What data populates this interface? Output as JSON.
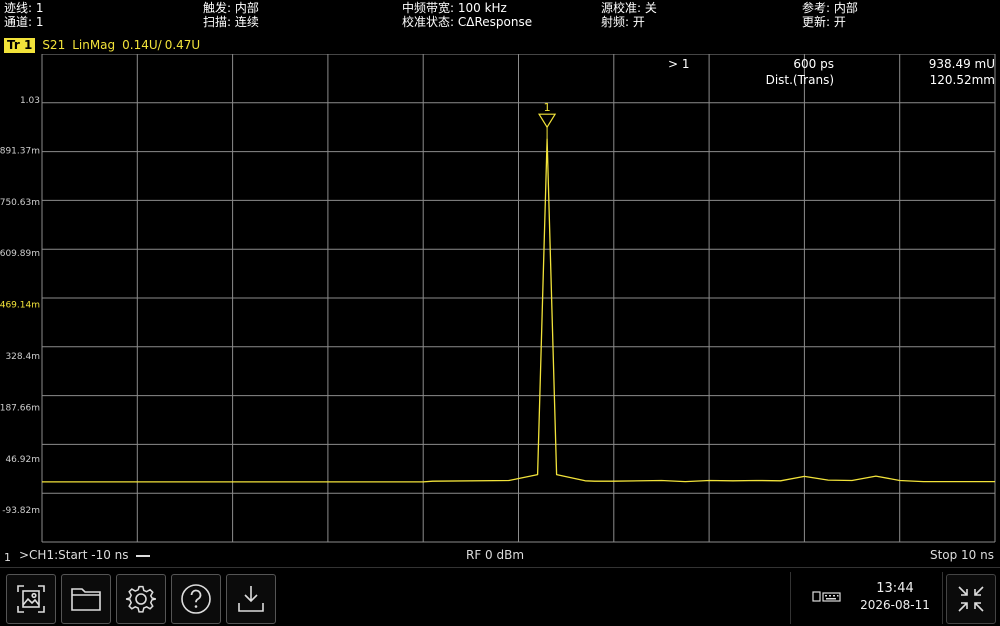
{
  "status": {
    "trace_count": "迹线: 1",
    "channel": "通道: 1",
    "trigger": "触发: 内部",
    "sweep": "扫描: 连续",
    "if_bw": "中频带宽: 100 kHz",
    "cal_state": "校准状态: CΔResponse",
    "source_cal": "源校准: 关",
    "rf": "射频: 开",
    "reference": "参考: 内部",
    "update": "更新: 开"
  },
  "trace": {
    "badge": "Tr 1",
    "param": "S21",
    "format": "LinMag",
    "scale": "0.14U/",
    "ref": "0.47U"
  },
  "marker_table": {
    "marker": "> 1",
    "x_value": "600 ps",
    "y_value": "938.49 mU",
    "x_label": "Dist.(Trans)",
    "distance": "120.52mm",
    "marker_label": "1"
  },
  "bottom": {
    "channel_marker": "1",
    "start": ">CH1:Start -10 ns",
    "power": "RF 0 dBm",
    "stop": "Stop 10 ns"
  },
  "clock": {
    "time": "13:44",
    "date": "2026-08-11"
  },
  "colors": {
    "trace": "#f2e33a",
    "grid": "#8c8c8c",
    "ref_label": "#f2e33a",
    "tick_label": "#cfcfcf"
  },
  "toolbar": {
    "buttons": [
      "screenshot-icon",
      "folder-icon",
      "gear-icon",
      "help-icon",
      "download-icon"
    ]
  },
  "chart_data": {
    "type": "line",
    "x": [
      -10,
      -3.0,
      -2.0,
      -1.8,
      -0.2,
      0.4,
      0.6,
      0.8,
      1.4,
      1.6,
      2.0,
      3.0,
      3.5,
      4.0,
      4.5,
      5.0,
      5.5,
      6.0,
      6.5,
      7.0,
      7.5,
      8.0,
      8.5,
      10
    ],
    "y": [
      0.0,
      0.0,
      0.0,
      0.002,
      0.004,
      0.02,
      0.9385,
      0.02,
      0.003,
      0.002,
      0.002,
      0.004,
      0.001,
      0.004,
      0.003,
      0.004,
      0.003,
      0.015,
      0.005,
      0.004,
      0.016,
      0.004,
      0.001,
      0.001
    ],
    "xlim": [
      -10,
      10
    ],
    "ylim": [
      -0.1645,
      1.1718
    ],
    "ytick_values": [
      1.03,
      0.89137,
      0.75063,
      0.60989,
      0.46914,
      0.3284,
      0.18766,
      0.04692,
      -0.09382
    ],
    "ytick_labels": [
      "1.03",
      "891.37m",
      "750.63m",
      "609.89m",
      "469.14m",
      "328.4m",
      "187.66m",
      "46.92m",
      "-93.82m"
    ],
    "reference_tick": "469.14m",
    "x_divisions": 10,
    "y_divisions": 10,
    "marker": {
      "x": 0.6,
      "y": 0.9385
    },
    "grid": true
  }
}
